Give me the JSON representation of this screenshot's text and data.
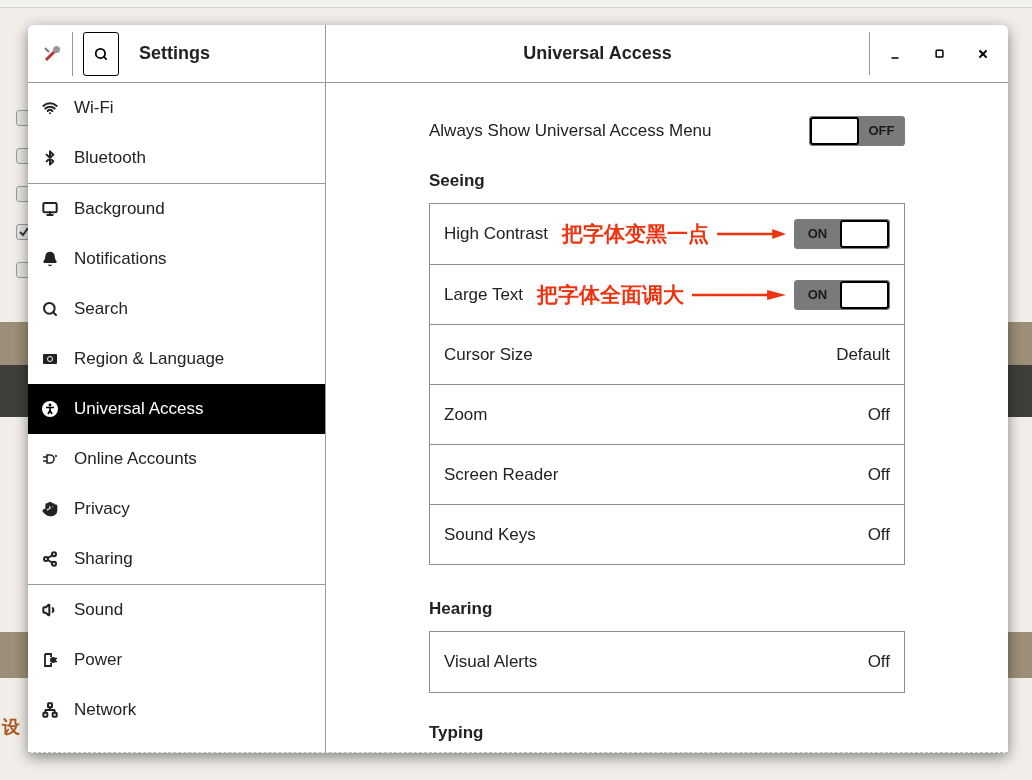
{
  "background": {
    "checkboxes": [
      {
        "checked": false
      },
      {
        "checked": false
      },
      {
        "checked": false
      },
      {
        "checked": true
      },
      {
        "checked": false
      }
    ],
    "fragment": "设"
  },
  "window": {
    "sidebar_title": "Settings",
    "title": "Universal Access",
    "search_toggled": true
  },
  "sidebar": {
    "groups": [
      [
        {
          "label": "Wi-Fi",
          "selected": false
        },
        {
          "label": "Bluetooth",
          "selected": false
        }
      ],
      [
        {
          "label": "Background",
          "selected": false
        },
        {
          "label": "Notifications",
          "selected": false
        },
        {
          "label": "Search",
          "selected": false
        },
        {
          "label": "Region & Language",
          "selected": false
        },
        {
          "label": "Universal Access",
          "selected": true
        },
        {
          "label": "Online Accounts",
          "selected": false
        },
        {
          "label": "Privacy",
          "selected": false
        },
        {
          "label": "Sharing",
          "selected": false
        }
      ],
      [
        {
          "label": "Sound",
          "selected": false
        },
        {
          "label": "Power",
          "selected": false
        },
        {
          "label": "Network",
          "selected": false
        }
      ]
    ]
  },
  "menu_option": {
    "label": "Always Show Universal Access Menu",
    "on": false,
    "state_text": "OFF"
  },
  "sections": [
    {
      "title": "Seeing",
      "rows": [
        {
          "kind": "switch",
          "label": "High Contrast",
          "on": true,
          "state_text": "ON",
          "annotation": "把字体变黑一点"
        },
        {
          "kind": "switch",
          "label": "Large Text",
          "on": true,
          "state_text": "ON",
          "annotation": "把字体全面调大"
        },
        {
          "kind": "value",
          "label": "Cursor Size",
          "value": "Default"
        },
        {
          "kind": "value",
          "label": "Zoom",
          "value": "Off"
        },
        {
          "kind": "value",
          "label": "Screen Reader",
          "value": "Off"
        },
        {
          "kind": "value",
          "label": "Sound Keys",
          "value": "Off"
        }
      ]
    },
    {
      "title": "Hearing",
      "rows": [
        {
          "kind": "value",
          "label": "Visual Alerts",
          "value": "Off"
        }
      ]
    },
    {
      "title": "Typing"
    }
  ]
}
